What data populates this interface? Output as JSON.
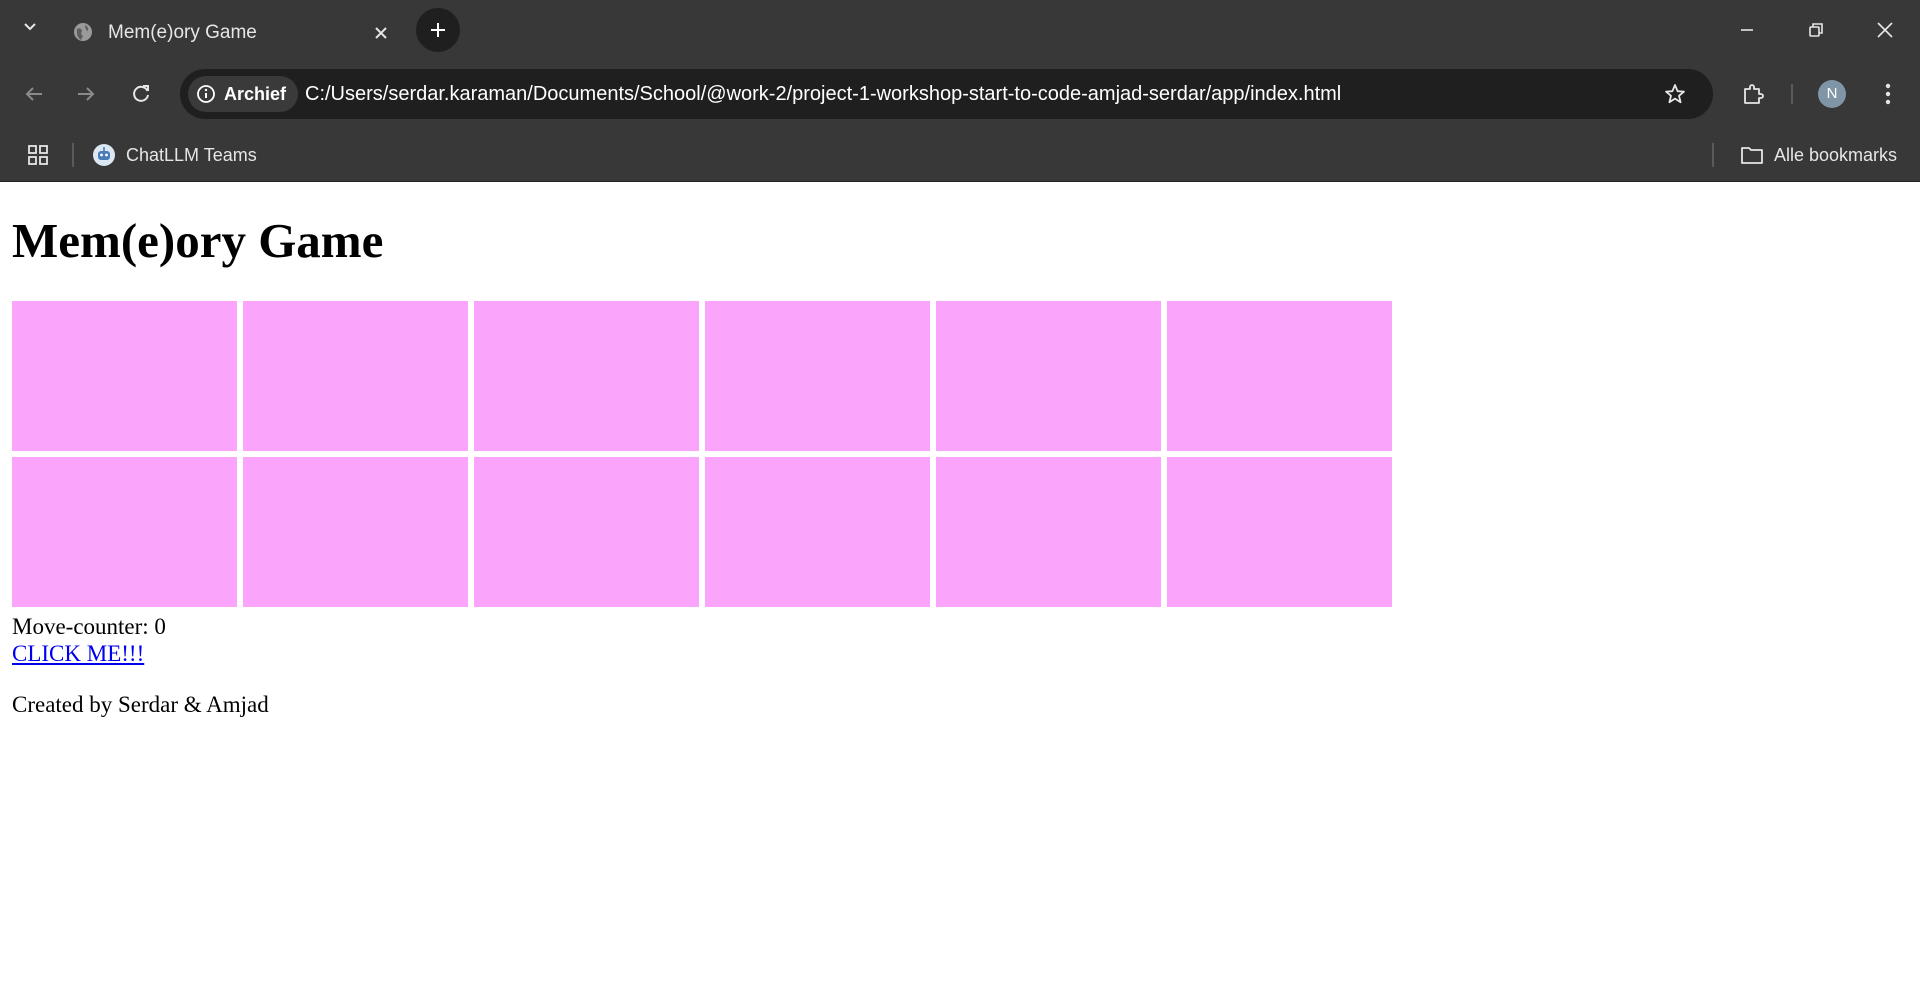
{
  "browser": {
    "tab": {
      "title": "Mem(e)ory Game",
      "favicon": "globe-icon"
    },
    "address_bar": {
      "site_chip_label": "Archief",
      "url": "C:/Users/serdar.karaman/Documents/School/@work-2/project-1-workshop-start-to-code-amjad-serdar/app/index.html"
    },
    "profile_initial": "N",
    "bookmarks": {
      "items": [
        {
          "label": "ChatLLM Teams",
          "icon": "chatllm-icon"
        }
      ],
      "all_bookmarks_label": "Alle bookmarks"
    },
    "colors": {
      "chrome_bg": "#383838",
      "omnibox_bg": "#1f1f1f",
      "avatar_bg": "#8095a6"
    }
  },
  "page": {
    "title": "Mem(e)ory Game",
    "cards": {
      "rows": 2,
      "columns": 6,
      "color": "#fba4fb"
    },
    "move_counter_text": "Move-counter: 0",
    "link_text": "CLICK ME!!!",
    "footer_text": "Created by Serdar & Amjad"
  }
}
